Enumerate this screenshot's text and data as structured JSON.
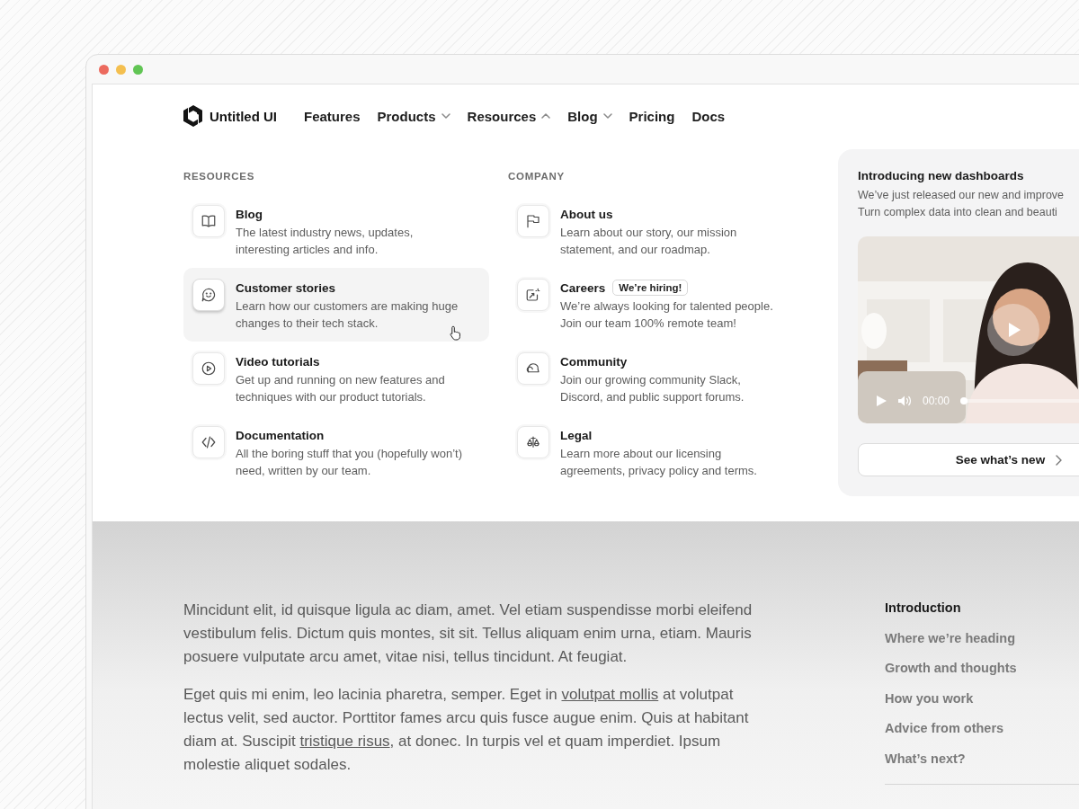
{
  "window": {
    "traffic_lights": [
      {
        "color": "#ec6a5e"
      },
      {
        "color": "#f4bf4f"
      },
      {
        "color": "#61c554"
      }
    ]
  },
  "nav": {
    "brand": "Untitled UI",
    "items": [
      {
        "label": "Features",
        "kind": "link"
      },
      {
        "label": "Products",
        "kind": "menu",
        "expanded": false
      },
      {
        "label": "Resources",
        "kind": "menu",
        "expanded": true
      },
      {
        "label": "Blog",
        "kind": "menu",
        "expanded": false
      },
      {
        "label": "Pricing",
        "kind": "link"
      },
      {
        "label": "Docs",
        "kind": "link"
      }
    ]
  },
  "menu": {
    "sections": [
      {
        "heading": "RESOURCES",
        "items": [
          {
            "title": "Blog",
            "description": "The latest industry news, updates, interesting articles and info.",
            "selected": false
          },
          {
            "title": "Customer stories",
            "description": "Learn how our customers are making huge changes to their tech stack.",
            "selected": true
          },
          {
            "title": "Video tutorials",
            "description": "Get up and running on new features and techniques with our product tutorials.",
            "selected": false
          },
          {
            "title": "Documentation",
            "description": "All the boring stuff that you (hopefully won’t) need, written by our team.",
            "selected": false
          }
        ]
      },
      {
        "heading": "COMPANY",
        "items": [
          {
            "title": "About us",
            "description": "Learn about our story, our mission statement, and our roadmap.",
            "selected": false
          },
          {
            "title": "Careers",
            "badge": "We’re hiring!",
            "description": "We’re always looking for talented people. Join our team 100% remote team!",
            "selected": false
          },
          {
            "title": "Community",
            "description": "Join our growing community Slack, Discord, and public support forums.",
            "selected": false
          },
          {
            "title": "Legal",
            "description": "Learn more about our licensing agreements, privacy policy and terms.",
            "selected": false
          }
        ]
      }
    ],
    "feature": {
      "title": "Introducing new dashboards",
      "lines": [
        "We’ve just released our new and improve",
        "Turn complex data into clean and beauti"
      ],
      "video": {
        "kind": "picture",
        "time": "00:00",
        "level": 0
      },
      "button": "See what’s new"
    }
  },
  "article": {
    "paragraphs": [
      {
        "parts": [
          {
            "kind": "text",
            "text": "Mincidunt elit, id quisque ligula ac diam, amet. Vel etiam suspendisse morbi eleifend vestibulum felis. Dictum quis montes, sit sit. Tellus aliquam enim urna, etiam. Mauris posuere vulputate arcu amet, vitae nisi, tellus tincidunt. At feugiat."
          }
        ]
      },
      {
        "parts": [
          {
            "kind": "text",
            "text": "Eget quis mi enim, leo lacinia pharetra, semper. Eget in "
          },
          {
            "kind": "link",
            "text": "volutpat mollis"
          },
          {
            "kind": "text",
            "text": " at volutpat lectus velit, sed auctor. Porttitor fames arcu quis fusce augue enim. Quis at habitant diam at. Suscipit "
          },
          {
            "kind": "link",
            "text": "tristique risus"
          },
          {
            "kind": "text",
            "text": ", at donec. In turpis vel et quam imperdiet. Ipsum molestie aliquet sodales."
          }
        ]
      }
    ],
    "toc": [
      {
        "label": "Introduction",
        "selected": true
      },
      {
        "label": "Where we’re heading",
        "selected": false
      },
      {
        "label": "Growth and thoughts",
        "selected": false
      },
      {
        "label": "How you work",
        "selected": false
      },
      {
        "label": "Advice from others",
        "selected": false
      },
      {
        "label": "What’s next?",
        "selected": false
      }
    ]
  }
}
